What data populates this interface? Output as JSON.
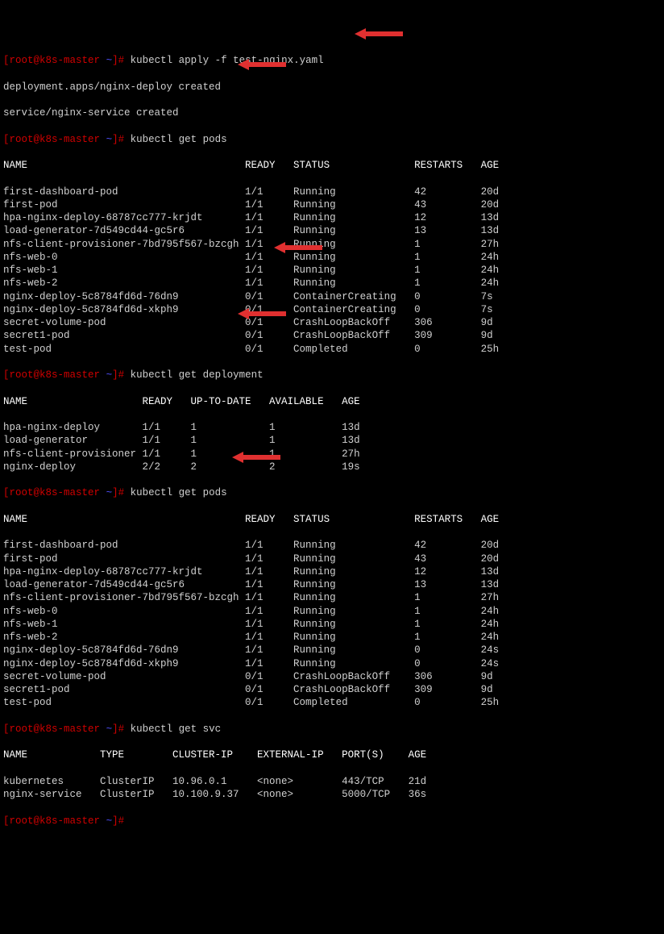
{
  "cmd1": {
    "prompt": "[root@k8s-master ~]# ",
    "command": "kubectl apply -f test-nginx.yaml"
  },
  "cmd1_output": {
    "line1": "deployment.apps/nginx-deploy created",
    "line2": "service/nginx-service created"
  },
  "cmd2": {
    "prompt": "[root@k8s-master ~]# ",
    "command": "kubectl get pods"
  },
  "pods_header": "NAME                                    READY   STATUS              RESTARTS   AGE",
  "pods1": [
    "first-dashboard-pod                     1/1     Running             42         20d",
    "first-pod                               1/1     Running             43         20d",
    "hpa-nginx-deploy-68787cc777-krjdt       1/1     Running             12         13d",
    "load-generator-7d549cd44-gc5r6          1/1     Running             13         13d",
    "nfs-client-provisioner-7bd795f567-bzcgh 1/1     Running             1          27h",
    "nfs-web-0                               1/1     Running             1          24h",
    "nfs-web-1                               1/1     Running             1          24h",
    "nfs-web-2                               1/1     Running             1          24h",
    "nginx-deploy-5c8784fd6d-76dn9           0/1     ContainerCreating   0          7s",
    "nginx-deploy-5c8784fd6d-xkph9           0/1     ContainerCreating   0          7s",
    "secret-volume-pod                       0/1     CrashLoopBackOff    306        9d",
    "secret1-pod                             0/1     CrashLoopBackOff    309        9d",
    "test-pod                                0/1     Completed           0          25h"
  ],
  "cmd3": {
    "prompt": "[root@k8s-master ~]# ",
    "command": "kubectl get deployment"
  },
  "deploy_header": "NAME                   READY   UP-TO-DATE   AVAILABLE   AGE",
  "deployments": [
    "hpa-nginx-deploy       1/1     1            1           13d",
    "load-generator         1/1     1            1           13d",
    "nfs-client-provisioner 1/1     1            1           27h",
    "nginx-deploy           2/2     2            2           19s"
  ],
  "cmd4": {
    "prompt": "[root@k8s-master ~]# ",
    "command": "kubectl get pods"
  },
  "pods2": [
    "first-dashboard-pod                     1/1     Running             42         20d",
    "first-pod                               1/1     Running             43         20d",
    "hpa-nginx-deploy-68787cc777-krjdt       1/1     Running             12         13d",
    "load-generator-7d549cd44-gc5r6          1/1     Running             13         13d",
    "nfs-client-provisioner-7bd795f567-bzcgh 1/1     Running             1          27h",
    "nfs-web-0                               1/1     Running             1          24h",
    "nfs-web-1                               1/1     Running             1          24h",
    "nfs-web-2                               1/1     Running             1          24h",
    "nginx-deploy-5c8784fd6d-76dn9           1/1     Running             0          24s",
    "nginx-deploy-5c8784fd6d-xkph9           1/1     Running             0          24s",
    "secret-volume-pod                       0/1     CrashLoopBackOff    306        9d",
    "secret1-pod                             0/1     CrashLoopBackOff    309        9d",
    "test-pod                                0/1     Completed           0          25h"
  ],
  "cmd5": {
    "prompt": "[root@k8s-master ~]# ",
    "command": "kubectl get svc"
  },
  "svc_header": "NAME            TYPE        CLUSTER-IP    EXTERNAL-IP   PORT(S)    AGE",
  "services": [
    "kubernetes      ClusterIP   10.96.0.1     <none>        443/TCP    21d",
    "nginx-service   ClusterIP   10.100.9.37   <none>        5000/TCP   36s"
  ],
  "cmd6": {
    "prompt": "[root@k8s-master ~]# ",
    "command": ""
  }
}
